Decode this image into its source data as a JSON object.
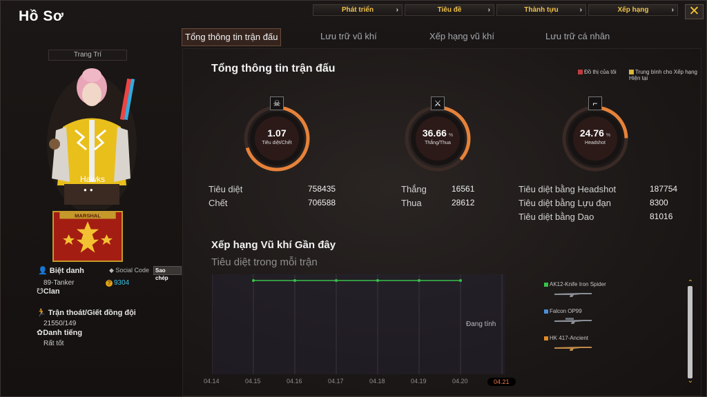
{
  "window": {
    "title": "Hồ Sơ",
    "close_label": "✕"
  },
  "topnav": [
    {
      "label": "Phát triển"
    },
    {
      "label": "Tiêu đề"
    },
    {
      "label": "Thành tựu"
    },
    {
      "label": "Xếp hạng"
    }
  ],
  "tabs": [
    {
      "label": "Tổng thông tin trận đấu",
      "active": true
    },
    {
      "label": "Lưu trữ vũ khí"
    },
    {
      "label": "Xếp hạng vũ khí"
    },
    {
      "label": "Lưu trữ cá nhân"
    }
  ],
  "profile": {
    "decorate_label": "Trang Trí",
    "character_name": "Hawks",
    "rank_badge_text": "MARSHAL",
    "nickname_label": "Biệt danh",
    "nickname": "89-Tanker",
    "social_code_label": "Social Code",
    "copy_label": "Sao chép",
    "coins": "9304",
    "clan_label": "Clan",
    "escape_label": "Trận thoát/Giết đồng đội",
    "escape_value": "21550/149",
    "reputation_label": "Danh tiếng",
    "reputation_value": "Rất tốt"
  },
  "summary": {
    "title": "Tổng thông tin trận đấu",
    "legend_mine": "Đồ thị của tôi",
    "legend_avg": "Trung bình cho Xếp hạng Hiện tại",
    "rings": [
      {
        "value": "1.07",
        "unit": "",
        "label": "Tiêu diệt/Chết",
        "fraction": 0.7
      },
      {
        "value": "36.66",
        "unit": "%",
        "label": "Thắng/Thua",
        "fraction": 0.3666
      },
      {
        "value": "24.76",
        "unit": "%",
        "label": "Headshot",
        "fraction": 0.2476
      }
    ],
    "stats_left": [
      {
        "label": "Tiêu diệt",
        "value": "758435"
      },
      {
        "label": "Chết",
        "value": "706588"
      }
    ],
    "stats_mid": [
      {
        "label": "Thắng",
        "value": "16561"
      },
      {
        "label": "Thua",
        "value": "28612"
      }
    ],
    "stats_right": [
      {
        "label": "Tiêu diệt bằng Headshot",
        "value": "187754"
      },
      {
        "label": "Tiêu diệt bằng Lựu đạn",
        "value": "8300"
      },
      {
        "label": "Tiêu diệt bằng Dao",
        "value": "81016"
      }
    ]
  },
  "recent": {
    "title": "Xếp hạng Vũ khí Gần đây",
    "subtitle": "Tiêu diệt trong mỗi trận",
    "status": "Đang tính",
    "weapons": [
      {
        "name": "AK12-Knife Iron Spider",
        "color": "#39c24a"
      },
      {
        "name": "Falcon OP99",
        "color": "#4a90d9"
      },
      {
        "name": "HK 417-Ancient",
        "color": "#e08a2a"
      }
    ]
  },
  "chart_data": {
    "type": "line",
    "x": [
      "04.14",
      "04.15",
      "04.16",
      "04.17",
      "04.18",
      "04.19",
      "04.20",
      "04.21"
    ],
    "highlight_x": "04.21",
    "series": [
      {
        "color": "#39c24a",
        "values": [
          null,
          0,
          0,
          0,
          0,
          0,
          0,
          null
        ]
      }
    ]
  }
}
